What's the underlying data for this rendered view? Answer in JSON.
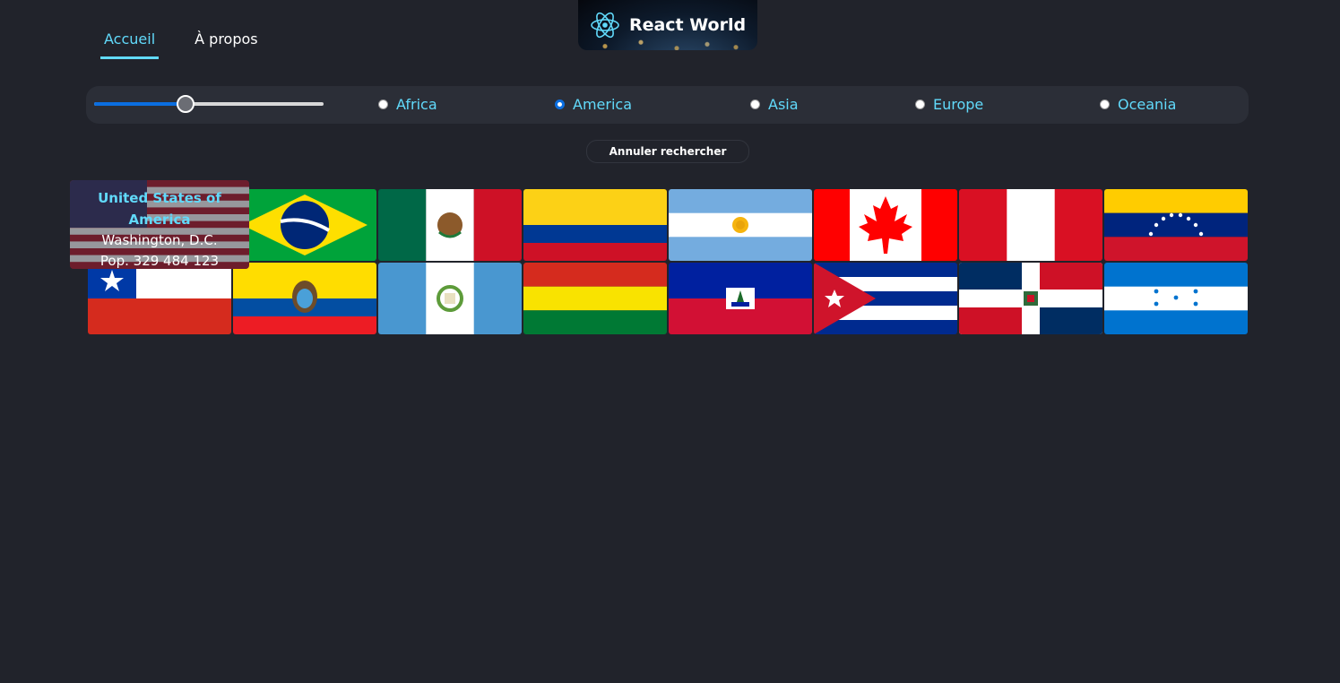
{
  "nav": {
    "home": "Accueil",
    "about": "À propos"
  },
  "logo": {
    "title": "React World",
    "icon": "react-atom-icon"
  },
  "filter": {
    "slider_fraction": 0.4,
    "regions": [
      "Africa",
      "America",
      "Asia",
      "Europe",
      "Oceania"
    ],
    "selected_region": "America"
  },
  "cancel_search": "Annuler rechercher",
  "tooltip": {
    "country_line1": "United States of",
    "country_line2": "America",
    "capital": "Washington, D.C.",
    "population": "Pop. 329 484 123"
  },
  "countries": [
    "United States of America",
    "Brazil",
    "Mexico",
    "Colombia",
    "Argentina",
    "Canada",
    "Peru",
    "Venezuela",
    "Chile",
    "Ecuador",
    "Guatemala",
    "Bolivia",
    "Haiti",
    "Cuba",
    "Dominican Republic",
    "Honduras"
  ],
  "colors": {
    "accent": "#61dafb",
    "background": "#21232b",
    "radio_selected": "#0b6ee0"
  }
}
